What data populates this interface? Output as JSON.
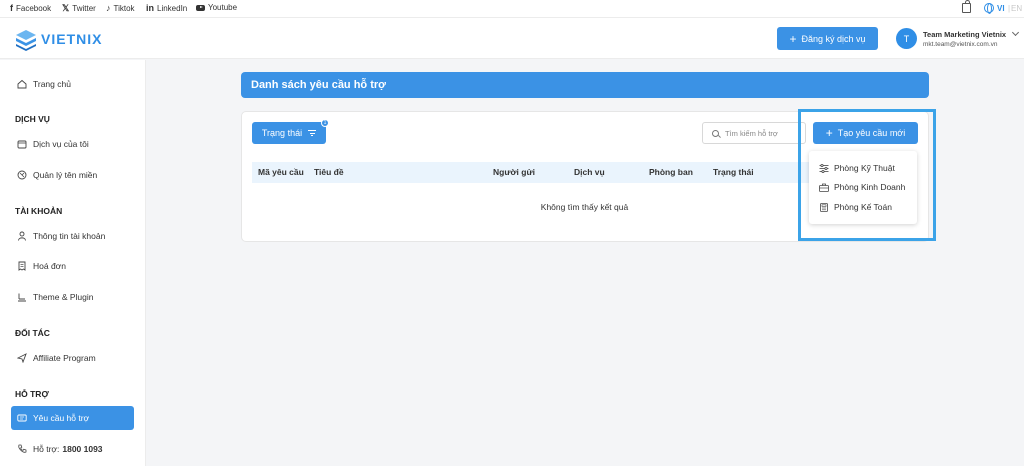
{
  "topbar": {
    "social": [
      {
        "label": "Facebook",
        "icon": "facebook-icon"
      },
      {
        "label": "Twitter",
        "icon": "x-icon"
      },
      {
        "label": "Tiktok",
        "icon": "tiktok-icon"
      },
      {
        "label": "LinkedIn",
        "icon": "linkedin-icon"
      },
      {
        "label": "Youtube",
        "icon": "youtube-icon"
      }
    ],
    "lang_active": "VI",
    "lang_inactive": "EN"
  },
  "header": {
    "logo_text": "VIETNIX",
    "register_label": "Đăng ký dịch vụ",
    "user_initial": "T",
    "user_name": "Team Marketing Vietnix",
    "user_email": "mkt.team@vietnix.com.vn"
  },
  "sidebar": {
    "home": "Trang chủ",
    "sections": {
      "services": "DỊCH VỤ",
      "account": "TÀI KHOẢN",
      "partner": "ĐỐI TÁC",
      "support": "HỖ TRỢ"
    },
    "my_services": "Dịch vụ của tôi",
    "domains": "Quản lý tên miền",
    "account_info": "Thông tin tài khoản",
    "invoices": "Hoá đơn",
    "themes": "Theme & Plugin",
    "affiliate": "Affiliate Program",
    "support_requests": "Yêu cầu hỗ trợ",
    "hotline_label": "Hỗ trợ:",
    "hotline_number": "1800 1093"
  },
  "main": {
    "title": "Danh sách yêu cầu hỗ trợ",
    "status_button": "Trạng thái",
    "status_badge": "1",
    "search_placeholder": "Tìm kiếm hỗ trợ",
    "new_request_button": "Tạo yêu cầu mới",
    "columns": [
      "Mã yêu cầu",
      "Tiêu đề",
      "Người gửi",
      "Dịch vụ",
      "Phòng ban",
      "Trạng thái"
    ],
    "empty_message": "Không tìm thấy kết quả"
  },
  "dropdown": {
    "items": [
      {
        "label": "Phòng Kỹ Thuật",
        "icon": "sliders-icon"
      },
      {
        "label": "Phòng Kinh Doanh",
        "icon": "briefcase-icon"
      },
      {
        "label": "Phòng Kế Toán",
        "icon": "calculator-icon"
      }
    ]
  },
  "colors": {
    "accent": "#3b92e5",
    "highlight_border": "#3ba3e8",
    "table_header_bg": "#eaf4fd"
  }
}
